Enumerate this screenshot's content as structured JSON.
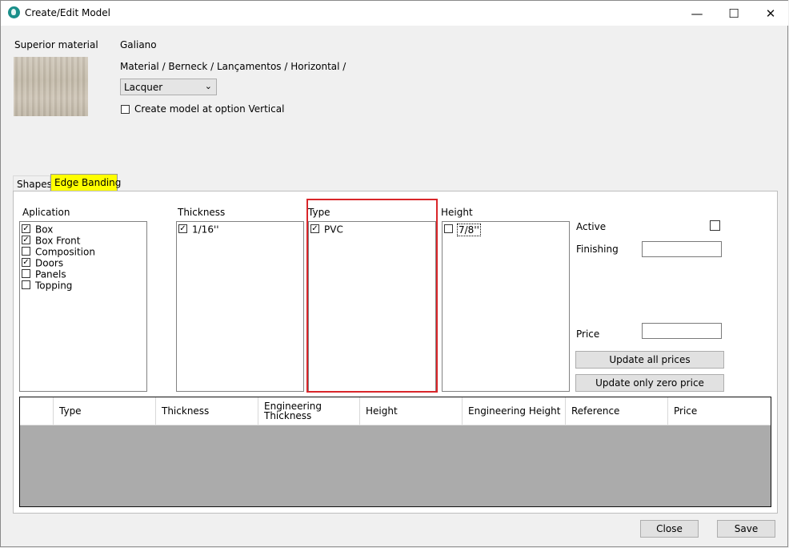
{
  "window": {
    "title": "Create/Edit Model",
    "minimize_glyph": "—",
    "maximize_glyph": "☐",
    "close_glyph": "✕"
  },
  "material": {
    "label": "Superior material",
    "name": "Galiano",
    "path": "Material / Berneck / Lançamentos / Horizontal /",
    "finish_selected": "Lacquer",
    "create_vertical_label": "Create model at option Vertical",
    "create_vertical_checked": false
  },
  "tabs": {
    "shapes": "Shapes",
    "edge_banding": "Edge Banding",
    "active": "edge_banding"
  },
  "aplication": {
    "header": "Aplication",
    "items": [
      {
        "label": "Box",
        "checked": true
      },
      {
        "label": "Box Front",
        "checked": true
      },
      {
        "label": "Composition",
        "checked": false
      },
      {
        "label": "Doors",
        "checked": true
      },
      {
        "label": "Panels",
        "checked": false
      },
      {
        "label": "Topping",
        "checked": false
      }
    ]
  },
  "thickness": {
    "header": "Thickness",
    "items": [
      {
        "label": "1/16''",
        "checked": true
      }
    ]
  },
  "type": {
    "header": "Type",
    "items": [
      {
        "label": "PVC",
        "checked": true
      }
    ]
  },
  "height": {
    "header": "Height",
    "items": [
      {
        "label": "7/8''",
        "checked": false
      }
    ]
  },
  "options": {
    "active_label": "Active",
    "active_checked": false,
    "finishing_label": "Finishing",
    "finishing_value": "",
    "price_label": "Price",
    "price_value": "",
    "update_all_label": "Update all prices",
    "update_zero_label": "Update only zero price"
  },
  "grid": {
    "columns": [
      "Type",
      "Thickness",
      "Engineering Thickness",
      "Height",
      "Engineering Height",
      "Reference",
      "Price"
    ],
    "rows": []
  },
  "footer": {
    "close_label": "Close",
    "save_label": "Save"
  },
  "colors": {
    "tab_highlight": "#ffff00",
    "annotation_box": "#d9262a",
    "grid_empty": "#ababab"
  },
  "icons": {
    "app": "app-logo-icon",
    "check": "check-icon",
    "dropdown": "chevron-down-icon"
  }
}
